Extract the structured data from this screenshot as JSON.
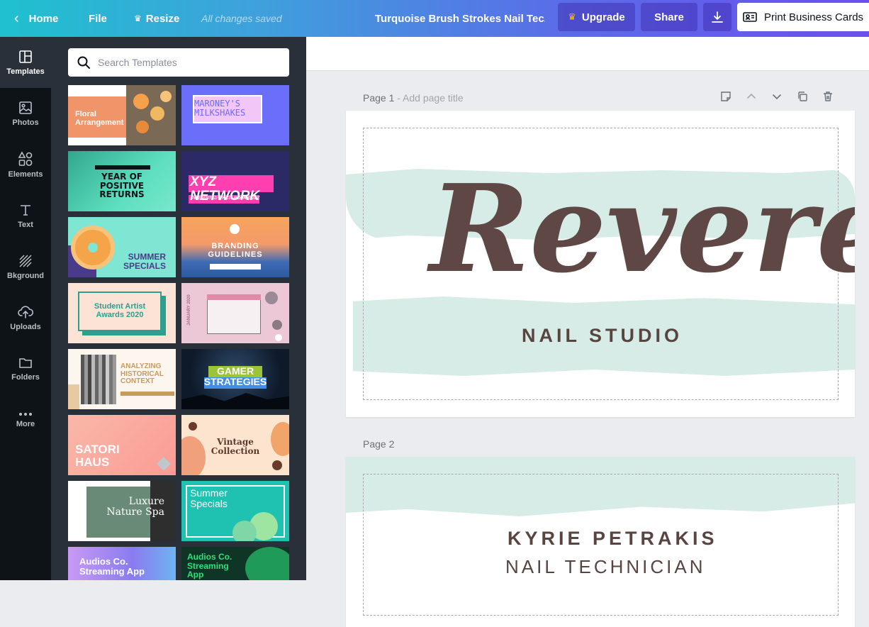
{
  "topbar": {
    "home": "Home",
    "file": "File",
    "resize": "Resize",
    "saved": "All changes saved",
    "doc_title": "Turquoise Brush Strokes Nail Tec...",
    "upgrade": "Upgrade",
    "share": "Share",
    "print": "Print Business Cards"
  },
  "rail": [
    {
      "label": "Templates",
      "icon": "templates-icon"
    },
    {
      "label": "Photos",
      "icon": "photos-icon"
    },
    {
      "label": "Elements",
      "icon": "elements-icon"
    },
    {
      "label": "Text",
      "icon": "text-icon"
    },
    {
      "label": "Bkground",
      "icon": "background-icon"
    },
    {
      "label": "Uploads",
      "icon": "uploads-icon"
    },
    {
      "label": "Folders",
      "icon": "folders-icon"
    },
    {
      "label": "More",
      "icon": "more-icon"
    }
  ],
  "search": {
    "placeholder": "Search Templates"
  },
  "templates": [
    {
      "lines": [
        "Floral",
        "Arrangement"
      ]
    },
    {
      "lines": [
        "MARONEY'S",
        "MILKSHAKES"
      ]
    },
    {
      "lines": [
        "YEAR OF",
        "POSITIVE RETURNS"
      ]
    },
    {
      "lines": [
        "XYZ NETWORK",
        "PRESENTED BY CIA RODRIGUEZ"
      ]
    },
    {
      "lines": [
        "SUMMER",
        "SPECIALS"
      ]
    },
    {
      "lines": [
        "BRANDING",
        "GUIDELINES"
      ]
    },
    {
      "lines": [
        "Student Artist",
        "Awards 2020"
      ]
    },
    {
      "lines": [
        "JANUARY 2020"
      ]
    },
    {
      "lines": [
        "ANALYZING",
        "HISTORICAL",
        "CONTEXT"
      ]
    },
    {
      "lines": [
        "GAMER",
        "STRATEGIES"
      ]
    },
    {
      "lines": [
        "SATORI",
        "HAUS"
      ]
    },
    {
      "lines": [
        "Vintage",
        "Collection"
      ]
    },
    {
      "lines": [
        "Luxure",
        "Nature Spa"
      ]
    },
    {
      "lines": [
        "Summer",
        "Specials"
      ]
    },
    {
      "lines": [
        "Audios Co.",
        "Streaming App"
      ]
    },
    {
      "lines": [
        "Audios Co.",
        "Streaming",
        "App"
      ]
    }
  ],
  "pages": [
    {
      "label": "Page 1",
      "title_placeholder": "Add page title",
      "logo": "Revere",
      "subtitle": "NAIL STUDIO"
    },
    {
      "label": "Page 2",
      "name": "KYRIE PETRAKIS",
      "role": "NAIL TECHNICIAN"
    }
  ]
}
